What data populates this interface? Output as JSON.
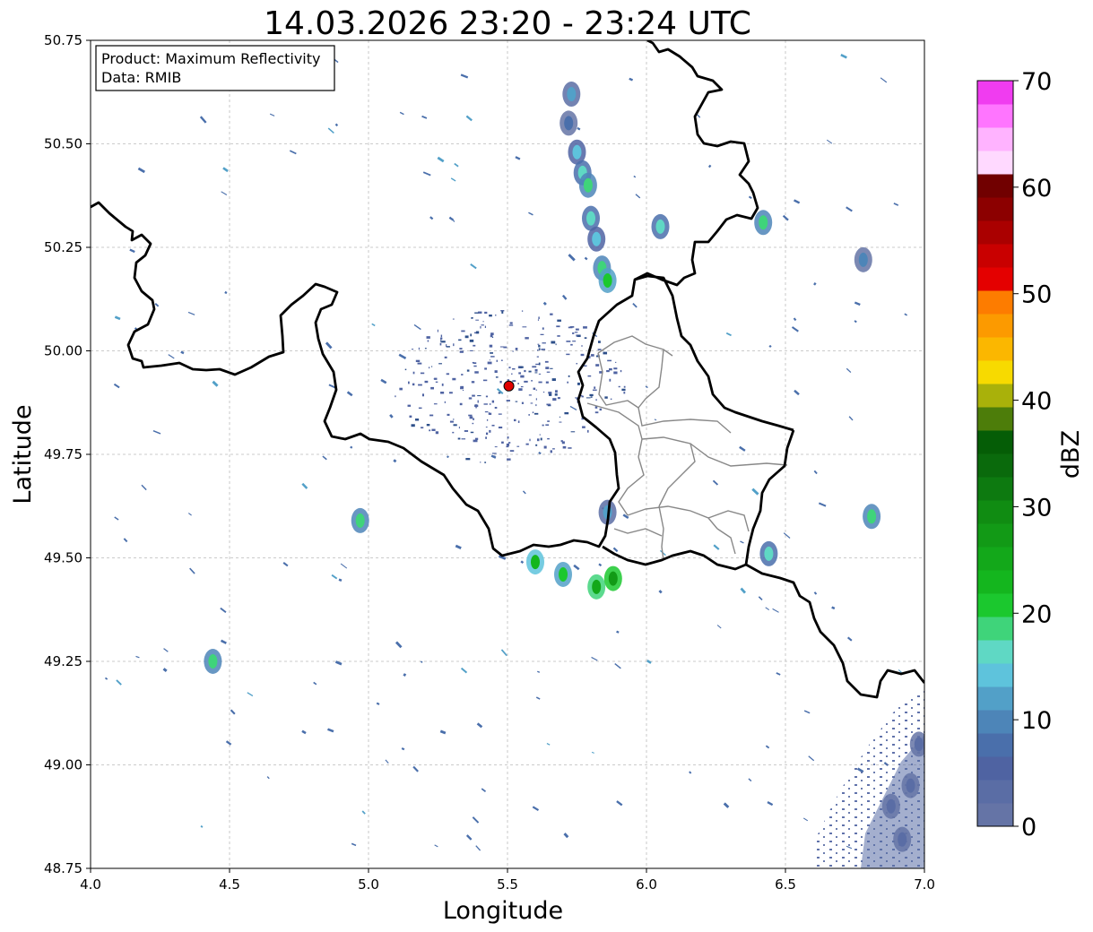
{
  "title": "14.03.2026 23:20 - 23:24 UTC",
  "info_box": {
    "product_line": "Product: Maximum Reflectivity",
    "data_line": "Data: RMIB"
  },
  "axes": {
    "xlabel": "Longitude",
    "ylabel": "Latitude",
    "xlim": [
      4.0,
      7.0
    ],
    "ylim": [
      48.75,
      50.75
    ],
    "xticks": [
      "4.0",
      "4.5",
      "5.0",
      "5.5",
      "6.0",
      "6.5",
      "7.0"
    ],
    "yticks": [
      "48.75",
      "49.00",
      "49.25",
      "49.50",
      "49.75",
      "50.00",
      "50.25",
      "50.50",
      "50.75"
    ],
    "grid": "dashed-gray"
  },
  "colorbar": {
    "label": "dBZ",
    "min": 0,
    "max": 70,
    "step": 2.5,
    "tick_labels": [
      "0",
      "10",
      "20",
      "30",
      "40",
      "50",
      "60",
      "70"
    ],
    "colors": [
      "#6574a6",
      "#5a6da5",
      "#4f63a2",
      "#4a6fab",
      "#4d85b8",
      "#52a0c8",
      "#5ec3dc",
      "#5fd8c4",
      "#3fd47a",
      "#1bc82e",
      "#14b61e",
      "#13a81a",
      "#129a16",
      "#108c12",
      "#0d7a10",
      "#0a6a0c",
      "#055d06",
      "#4d7d0a",
      "#a9b10a",
      "#f7da00",
      "#fbb700",
      "#fc9a00",
      "#fd7c00",
      "#e40000",
      "#c90000",
      "#aa0000",
      "#8c0000",
      "#710000",
      "#ffd9ff",
      "#ffb3ff",
      "#ff75ff",
      "#f03cf0"
    ]
  },
  "chart_data": {
    "type": "map",
    "title": "14.03.2026 23:20 - 23:24 UTC",
    "xlabel": "Longitude",
    "ylabel": "Latitude",
    "xlim": [
      4.0,
      7.0
    ],
    "ylim": [
      48.75,
      50.75
    ],
    "radar_site": {
      "lon": 5.505,
      "lat": 49.915,
      "color": "#e00000"
    },
    "reflectivity_cells": [
      {
        "lon": 5.72,
        "lat": 50.55,
        "dbz": 8
      },
      {
        "lon": 5.73,
        "lat": 50.62,
        "dbz": 12
      },
      {
        "lon": 5.75,
        "lat": 50.48,
        "dbz": 14
      },
      {
        "lon": 5.77,
        "lat": 50.43,
        "dbz": 16
      },
      {
        "lon": 5.79,
        "lat": 50.4,
        "dbz": 18
      },
      {
        "lon": 5.8,
        "lat": 50.32,
        "dbz": 16
      },
      {
        "lon": 5.82,
        "lat": 50.27,
        "dbz": 14
      },
      {
        "lon": 5.84,
        "lat": 50.2,
        "dbz": 18
      },
      {
        "lon": 5.86,
        "lat": 50.17,
        "dbz": 20
      },
      {
        "lon": 5.6,
        "lat": 49.49,
        "dbz": 22
      },
      {
        "lon": 5.82,
        "lat": 49.43,
        "dbz": 26
      },
      {
        "lon": 5.88,
        "lat": 49.45,
        "dbz": 28
      },
      {
        "lon": 5.7,
        "lat": 49.46,
        "dbz": 20
      },
      {
        "lon": 4.97,
        "lat": 49.59,
        "dbz": 18
      },
      {
        "lon": 4.44,
        "lat": 49.25,
        "dbz": 18
      },
      {
        "lon": 6.42,
        "lat": 50.31,
        "dbz": 18
      },
      {
        "lon": 6.78,
        "lat": 50.22,
        "dbz": 10
      },
      {
        "lon": 6.81,
        "lat": 49.6,
        "dbz": 18
      },
      {
        "lon": 6.44,
        "lat": 49.51,
        "dbz": 16
      },
      {
        "lon": 6.05,
        "lat": 50.3,
        "dbz": 16
      },
      {
        "lon": 5.86,
        "lat": 49.61,
        "dbz": 12
      },
      {
        "lon": 6.88,
        "lat": 48.9,
        "dbz": 4
      },
      {
        "lon": 6.95,
        "lat": 48.95,
        "dbz": 4
      },
      {
        "lon": 6.98,
        "lat": 49.05,
        "dbz": 4
      },
      {
        "lon": 6.92,
        "lat": 48.82,
        "dbz": 4
      }
    ],
    "colorbar_label": "dBZ",
    "colorbar_range": [
      0,
      70
    ]
  }
}
